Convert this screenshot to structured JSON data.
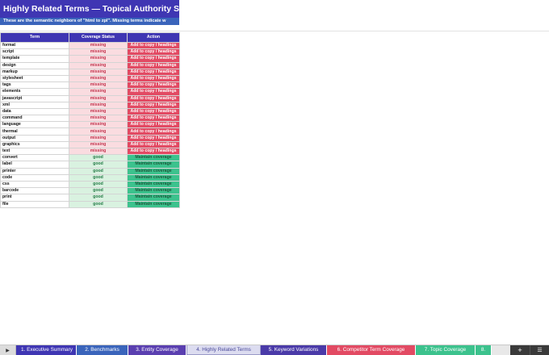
{
  "sheet": {
    "title": "Highly Related Terms — Topical Authority Signals",
    "subtitle": "These are the semantic neighbors of \"html to zpl\". Missing terms indicate w",
    "headers": {
      "term": "Term",
      "status": "Coverage Status",
      "action": "Action"
    },
    "rows": [
      {
        "term": "format",
        "status": "missing",
        "action": "Add to copy / headings"
      },
      {
        "term": "script",
        "status": "missing",
        "action": "Add to copy / headings"
      },
      {
        "term": "template",
        "status": "missing",
        "action": "Add to copy / headings"
      },
      {
        "term": "design",
        "status": "missing",
        "action": "Add to copy / headings"
      },
      {
        "term": "markup",
        "status": "missing",
        "action": "Add to copy / headings"
      },
      {
        "term": "stylesheet",
        "status": "missing",
        "action": "Add to copy / headings"
      },
      {
        "term": "tags",
        "status": "missing",
        "action": "Add to copy / headings"
      },
      {
        "term": "elements",
        "status": "missing",
        "action": "Add to copy / headings"
      },
      {
        "term": "javascript",
        "status": "missing",
        "action": "Add to copy / headings"
      },
      {
        "term": "xml",
        "status": "missing",
        "action": "Add to copy / headings"
      },
      {
        "term": "data",
        "status": "missing",
        "action": "Add to copy / headings"
      },
      {
        "term": "command",
        "status": "missing",
        "action": "Add to copy / headings"
      },
      {
        "term": "language",
        "status": "missing",
        "action": "Add to copy / headings"
      },
      {
        "term": "thermal",
        "status": "missing",
        "action": "Add to copy / headings"
      },
      {
        "term": "output",
        "status": "missing",
        "action": "Add to copy / headings"
      },
      {
        "term": "graphics",
        "status": "missing",
        "action": "Add to copy / headings"
      },
      {
        "term": "text",
        "status": "missing",
        "action": "Add to copy / headings"
      },
      {
        "term": "convert",
        "status": "good",
        "action": "Maintain coverage"
      },
      {
        "term": "label",
        "status": "good",
        "action": "Maintain coverage"
      },
      {
        "term": "printer",
        "status": "good",
        "action": "Maintain coverage"
      },
      {
        "term": "code",
        "status": "good",
        "action": "Maintain coverage"
      },
      {
        "term": "css",
        "status": "good",
        "action": "Maintain coverage"
      },
      {
        "term": "barcode",
        "status": "good",
        "action": "Maintain coverage"
      },
      {
        "term": "print",
        "status": "good",
        "action": "Maintain coverage"
      },
      {
        "term": "file",
        "status": "good",
        "action": "Maintain coverage"
      }
    ]
  },
  "tabs": [
    {
      "label": "1. Executive Summary",
      "color": "#3f36b3",
      "active": false
    },
    {
      "label": "2. Benchmarks",
      "color": "#3a64bb",
      "active": false
    },
    {
      "label": "3. Entity Coverage",
      "color": "#5a3fb0",
      "active": false
    },
    {
      "label": "4. Highly Related Terms",
      "color": "#dcdcf0",
      "active": true
    },
    {
      "label": "5. Keyword Variations",
      "color": "#4a3aa8",
      "active": false
    },
    {
      "label": "6. Competitor Term Coverage",
      "color": "#e24a63",
      "active": false
    },
    {
      "label": "7. Topic Coverage",
      "color": "#3cc28d",
      "active": false
    },
    {
      "label": "8.",
      "color": "#3cc28d",
      "active": false
    }
  ],
  "controls": {
    "nav_icon": "play-icon",
    "add_label": "+",
    "menu_icon": "hamburger-icon"
  }
}
